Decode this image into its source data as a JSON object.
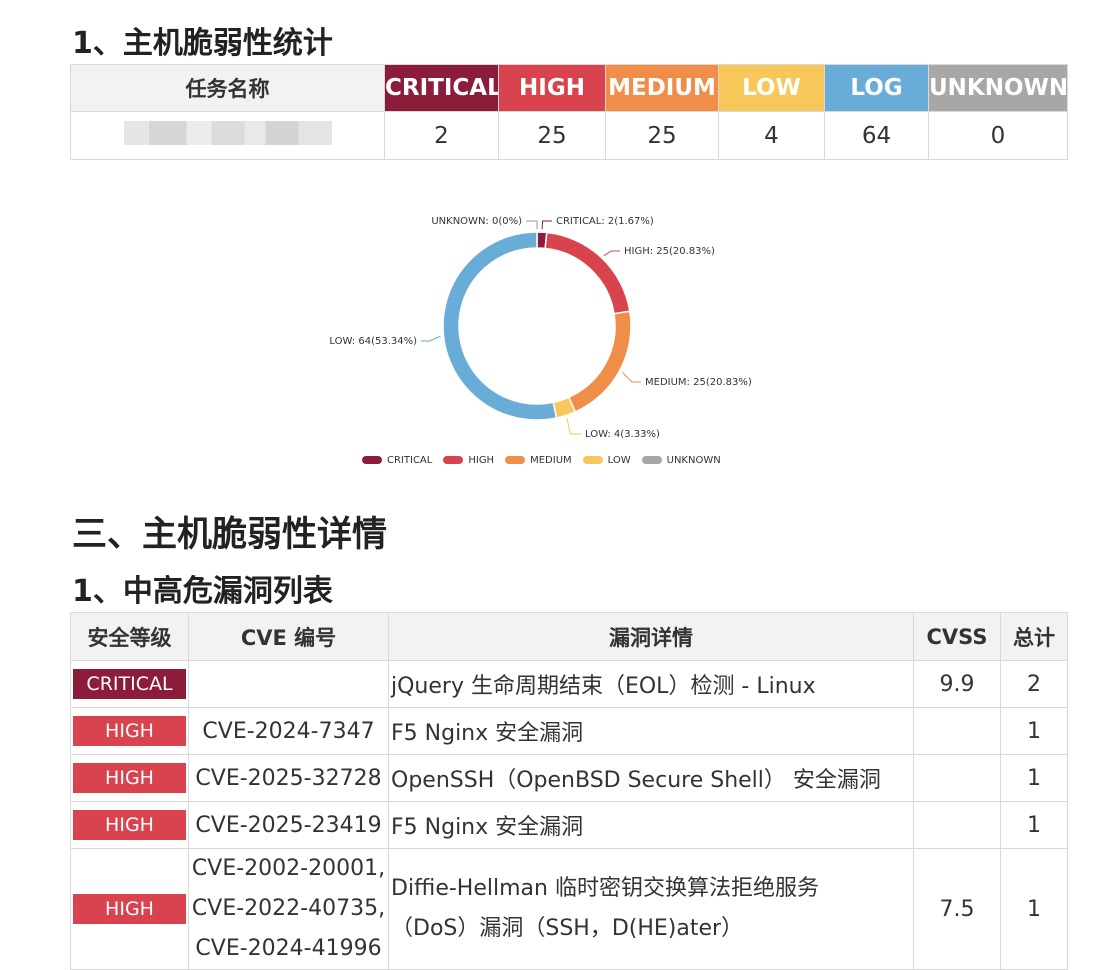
{
  "headings": {
    "stats": "1、主机脆弱性统计",
    "details": "三、主机脆弱性详情",
    "list": "1、中高危漏洞列表"
  },
  "summary": {
    "task_header": "任务名称",
    "levels": [
      {
        "label": "CRITICAL",
        "value": "2",
        "color": "#8b1d3b"
      },
      {
        "label": "HIGH",
        "value": "25",
        "color": "#d9434e"
      },
      {
        "label": "MEDIUM",
        "value": "25",
        "color": "#f08e49"
      },
      {
        "label": "LOW",
        "value": "4",
        "color": "#f7c75a"
      },
      {
        "label": "LOG",
        "value": "64",
        "color": "#68acd7"
      },
      {
        "label": "UNKNOWN",
        "value": "0",
        "color": "#a7a7a7"
      }
    ]
  },
  "chart_data": {
    "type": "pie",
    "donut": true,
    "slices": [
      {
        "name": "CRITICAL",
        "value": 2,
        "label": "CRITICAL: 2(1.67%)",
        "color": "#8b1d3b"
      },
      {
        "name": "HIGH",
        "value": 25,
        "label": "HIGH: 25(20.83%)",
        "color": "#d9434e"
      },
      {
        "name": "MEDIUM",
        "value": 25,
        "label": "MEDIUM: 25(20.83%)",
        "color": "#f08e49"
      },
      {
        "name": "LOW",
        "value": 4,
        "label": "LOW: 4(3.33%)",
        "color": "#f7c75a"
      },
      {
        "name": "LOW",
        "value": 64,
        "label": "LOW: 64(53.34%)",
        "color": "#68acd7"
      },
      {
        "name": "UNKNOWN",
        "value": 0,
        "label": "UNKNOWN: 0(0%)",
        "color": "#a7a7a7"
      }
    ],
    "legend": [
      {
        "name": "CRITICAL",
        "color": "#8b1d3b"
      },
      {
        "name": "HIGH",
        "color": "#d9434e"
      },
      {
        "name": "MEDIUM",
        "color": "#f08e49"
      },
      {
        "name": "LOW",
        "color": "#f7c75a"
      },
      {
        "name": "UNKNOWN",
        "color": "#a7a7a7"
      }
    ],
    "legend_position": "bottom"
  },
  "detail": {
    "headers": [
      "安全等级",
      "CVE 编号",
      "漏洞详情",
      "CVSS",
      "总计"
    ],
    "rows": [
      {
        "level": "CRITICAL",
        "color": "#8b1d3b",
        "cve": "",
        "desc": "jQuery 生命周期结束（EOL）检测 - Linux",
        "cvss": "9.9",
        "total": "2"
      },
      {
        "level": "HIGH",
        "color": "#d9434e",
        "cve": "CVE-2024-7347",
        "desc": "F5 Nginx 安全漏洞",
        "cvss": "",
        "total": "1"
      },
      {
        "level": "HIGH",
        "color": "#d9434e",
        "cve": "CVE-2025-32728",
        "desc": "OpenSSH（OpenBSD Secure Shell） 安全漏洞",
        "cvss": "",
        "total": "1"
      },
      {
        "level": "HIGH",
        "color": "#d9434e",
        "cve": "CVE-2025-23419",
        "desc": "F5 Nginx 安全漏洞",
        "cvss": "",
        "total": "1"
      },
      {
        "level": "HIGH",
        "color": "#d9434e",
        "cve_lines": [
          "CVE-2002-20001,",
          "CVE-2022-40735,",
          "CVE-2024-41996"
        ],
        "desc_lines": [
          "Diffie-Hellman 临时密钥交换算法拒绝服务",
          "（DoS）漏洞（SSH，D(HE)ater）"
        ],
        "cvss": "7.5",
        "total": "1"
      }
    ]
  }
}
